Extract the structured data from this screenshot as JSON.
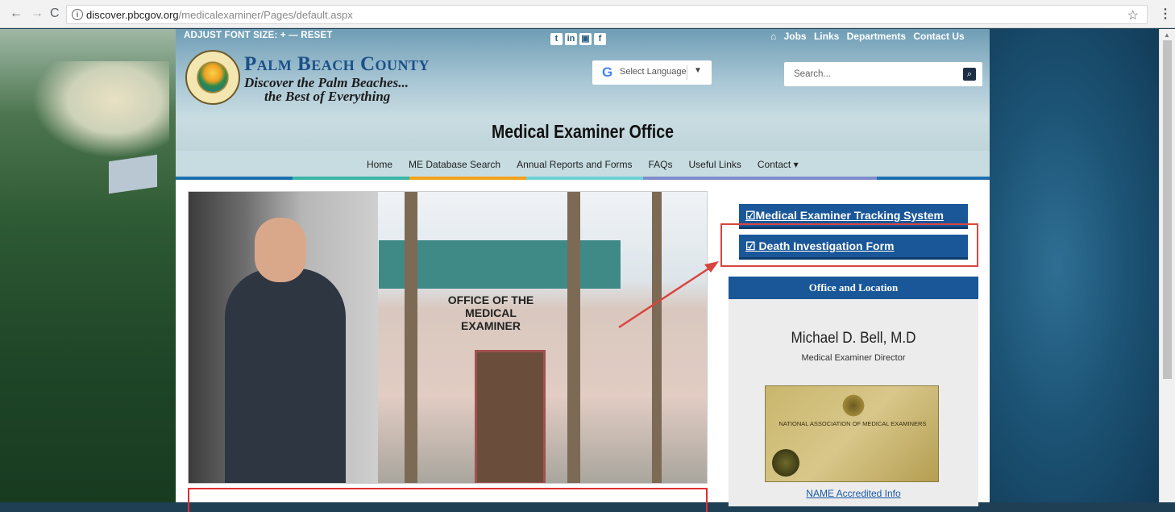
{
  "browser": {
    "url_domain": "discover.pbcgov.org",
    "url_path": "/medicalexaminer/Pages/default.aspx",
    "back": "←",
    "forward": "→",
    "reload": "C",
    "star": "☆",
    "menu": "⋮"
  },
  "topbar": {
    "font_size_label": "ADJUST FONT SIZE: + — RESET",
    "social": [
      "t",
      "in",
      "▣",
      "f"
    ],
    "home_glyph": "⌂",
    "links": [
      "Jobs",
      "Links",
      "Departments",
      "Contact Us"
    ]
  },
  "brand": {
    "name": "Palm Beach County",
    "tagline_1": "Discover the Palm Beaches...",
    "tagline_2": "the Best of Everything"
  },
  "language": {
    "g": "G",
    "label": "Select Language",
    "arrow": "▼"
  },
  "search": {
    "placeholder": "Search...",
    "icon": "⌕"
  },
  "page_title": "Medical Examiner Office",
  "nav": [
    "Home",
    "ME Database Search",
    "Annual Reports and Forms",
    "FAQs",
    "Useful Links",
    "Contact ▾"
  ],
  "photo": {
    "sign": "OFFICE OF THE MEDICAL EXAMINER"
  },
  "side_buttons": {
    "tracking": "☑Medical Examiner Tracking System",
    "death_form": "☑ Death Investigation Form"
  },
  "office": {
    "heading": "Office and Location",
    "name": "Michael D. Bell, M.D",
    "role": "Medical Examiner Director",
    "cert_title": "NATIONAL ASSOCIATION OF MEDICAL EXAMINERS",
    "cert_link": "NAME Accredited Info"
  },
  "colors": {
    "accent_blue": "#1a5799",
    "highlight_red": "#d9453f",
    "nav_strip": [
      "#1b6fae",
      "#3ab6a6",
      "#f0a21a",
      "#6bd2d6",
      "#7f8ccc",
      "#1b6fae"
    ]
  }
}
